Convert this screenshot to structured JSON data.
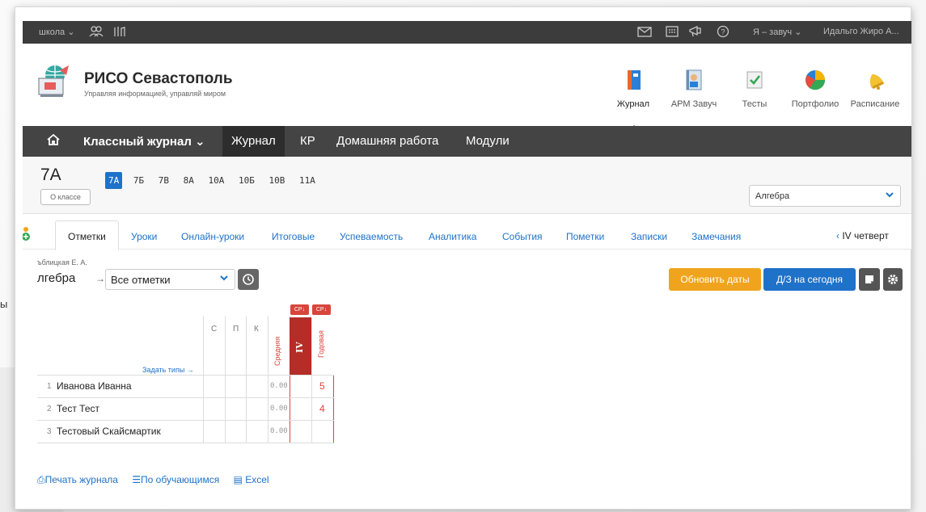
{
  "topbar": {
    "school_menu": "школа ⌄",
    "role_menu": "Я – завуч ⌄",
    "user_name": "Идальго Жиро А..."
  },
  "header": {
    "title": "РИСО Севастополь",
    "subtitle": "Управляя информацией, управляй миром",
    "apps": [
      {
        "label": "Журнал",
        "icon": "journal-icon",
        "active": true
      },
      {
        "label": "АРМ Завуч",
        "icon": "vice-principal-icon"
      },
      {
        "label": "Тесты",
        "icon": "tests-icon"
      },
      {
        "label": "Портфолио",
        "icon": "portfolio-icon"
      },
      {
        "label": "Расписание",
        "icon": "schedule-bell-icon"
      }
    ]
  },
  "nav": {
    "class_journal": "Классный журнал ⌄",
    "items": [
      "Журнал",
      "КР",
      "Домашняя работа",
      "Модули"
    ]
  },
  "classbar": {
    "current_class": "7А",
    "about_button": "О классе",
    "classes": [
      "7А",
      "7Б",
      "7В",
      "8А",
      "10А",
      "10Б",
      "10В",
      "11А"
    ],
    "active_class": "7А",
    "subject_select": "Алгебра"
  },
  "tabs": {
    "items": [
      "Отметки",
      "Уроки",
      "Онлайн-уроки",
      "Итоговые",
      "Успеваемость",
      "Аналитика",
      "События",
      "Пометки",
      "Записки",
      "Замечания"
    ],
    "active": "Отметки",
    "quarter": "IV четверт"
  },
  "toolbar": {
    "teacher": "ъблицкая Е. А.",
    "subject": "лгебра",
    "arrow": "→",
    "filter_value": "Все отметки",
    "update_dates": "Обновить даты",
    "hw_today": "Д/З на сегодня"
  },
  "stray_char": "ы",
  "gradebook": {
    "col_c": "С",
    "col_p": "П",
    "col_k": "К",
    "col_avg": "Средняя",
    "col_iv": "IV",
    "col_year": "Годовая",
    "cp_label": "СР↓",
    "set_types": "Задать типы →",
    "rows": [
      {
        "num": "1",
        "name": "Иванова Иванна",
        "avg": "0.00",
        "year": "5"
      },
      {
        "num": "2",
        "name": "Тест Тест",
        "avg": "0.00",
        "year": "4"
      },
      {
        "num": "3",
        "name": "Тестовый Скайсмартик",
        "avg": "0.00",
        "year": ""
      }
    ]
  },
  "footer": {
    "print": "Печать журнала",
    "by_student": "По обучающимся",
    "excel": "Excel"
  }
}
